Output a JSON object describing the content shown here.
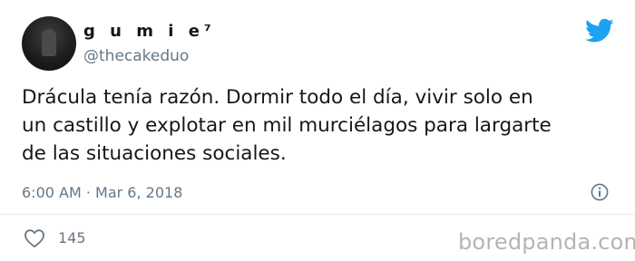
{
  "author": {
    "display_name": "g u m i e⁷",
    "handle": "@thecakeduo"
  },
  "tweet": {
    "line1": "Drácula tenía razón. Dormir todo el día, vivir solo en",
    "line2": "un castillo y explotar en mil murciélagos para largarte",
    "line3": "de las situaciones sociales.",
    "timestamp": "6:00 AM · Mar 6, 2018",
    "likes": "145"
  },
  "watermark": "boredpanda.com",
  "icons": {
    "brand": "twitter-bird-icon",
    "info": "info-icon",
    "like": "heart-icon"
  },
  "colors": {
    "brand_blue": "#1da1f2",
    "secondary_text": "#657786",
    "primary_text": "#14171a"
  }
}
